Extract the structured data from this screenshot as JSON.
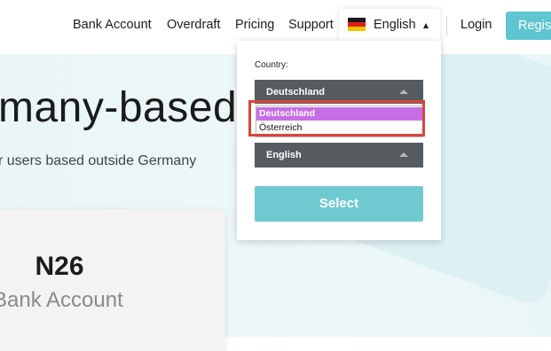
{
  "nav": {
    "links": [
      "Bank Account",
      "Overdraft",
      "Pricing",
      "Support"
    ],
    "language": "English",
    "login": "Login",
    "register": "Regist"
  },
  "hero": {
    "heading": "many-based",
    "subtext": "r users based outside Germany"
  },
  "card": {
    "title": "N26",
    "subtitle": "Bank Account"
  },
  "dropdown": {
    "country_label": "Country:",
    "country_selected": "Deutschland",
    "country_options": [
      "Deutschland",
      "Österreich"
    ],
    "language_selected": "English",
    "select_button": "Select"
  },
  "colors": {
    "accent": "#5fc5d0",
    "option_highlight": "#c76ee6",
    "annotation_box": "#d7463b",
    "select_bg": "#555b5f"
  },
  "icons": {
    "flag": "germany-flag-icon",
    "language_caret": "caret-up-icon",
    "select_caret": "triangle-up-icon"
  }
}
